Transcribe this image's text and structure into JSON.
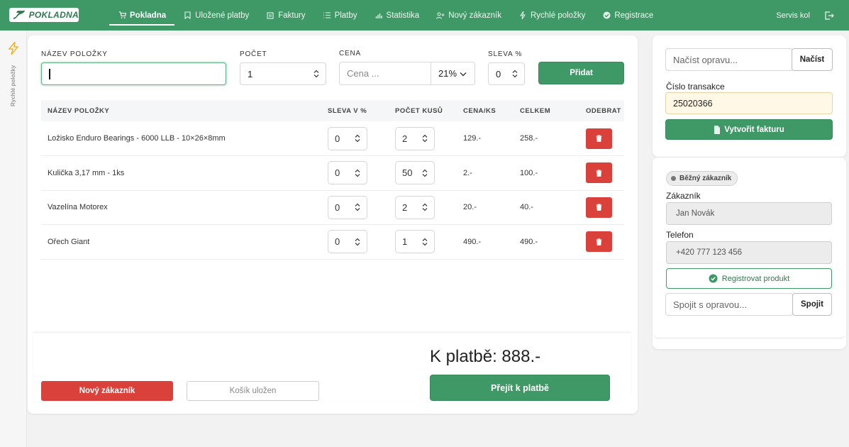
{
  "brand": {
    "name": "POKLADNA"
  },
  "nav": {
    "items": [
      {
        "label": "Pokladna",
        "icon": "cart-icon",
        "active": true
      },
      {
        "label": "Uložené platby",
        "icon": "bookmark-icon",
        "active": false
      },
      {
        "label": "Faktury",
        "icon": "document-icon",
        "active": false
      },
      {
        "label": "Platby",
        "icon": "list-icon",
        "active": false
      },
      {
        "label": "Statistika",
        "icon": "chart-icon",
        "active": false
      },
      {
        "label": "Nový zákazník",
        "icon": "user-plus-icon",
        "active": false
      },
      {
        "label": "Rychlé položky",
        "icon": "bolt-icon",
        "active": false
      },
      {
        "label": "Registrace",
        "icon": "check-badge-icon",
        "active": false
      }
    ],
    "user": "Servis kol"
  },
  "rail": {
    "label": "Rychlé položky"
  },
  "form": {
    "name_label": "NÁZEV POLOŽKY",
    "name_value": "",
    "count_label": "POČET",
    "count_value": "1",
    "price_label": "CENA",
    "price_placeholder": "Cena ...",
    "vat_value": "21%",
    "discount_label": "SLEVA %",
    "discount_value": "0",
    "add_label": "Přidat"
  },
  "table": {
    "headers": [
      "NÁZEV POLOŽKY",
      "SLEVA V %",
      "POČET KUSŮ",
      "CENA/KS",
      "CELKEM",
      "ODEBRAT"
    ],
    "rows": [
      {
        "name": "Ložisko Enduro Bearings - 6000 LLB - 10×26×8mm",
        "discount": "0",
        "qty": "2",
        "unit": "129.-",
        "total": "258.-"
      },
      {
        "name": "Kulička 3,17 mm - 1ks",
        "discount": "0",
        "qty": "50",
        "unit": "2.-",
        "total": "100.-"
      },
      {
        "name": "Vazelína Motorex",
        "discount": "0",
        "qty": "2",
        "unit": "20.-",
        "total": "40.-"
      },
      {
        "name": "Ořech Giant",
        "discount": "0",
        "qty": "1",
        "unit": "490.-",
        "total": "490.-"
      }
    ]
  },
  "footer": {
    "total": "K platbě: 888.-",
    "new_customer": "Nový zákazník",
    "cart_saved": "Košík uložen",
    "pay": "Přejít k platbě"
  },
  "right": {
    "load_placeholder": "Načíst opravu...",
    "load_button": "Načíst",
    "transaction_label": "Číslo transakce",
    "transaction_value": "25020366",
    "invoice_button": "Vytvořit fakturu",
    "badge": "Běžný zákazník",
    "customer_label": "Zákazník",
    "customer_value": "Jan Novák",
    "phone_label": "Telefon",
    "phone_value": "+420 777 123 456",
    "register_button": "Registrovat produkt",
    "link_placeholder": "Spojit s opravou...",
    "link_button": "Spojit"
  },
  "colors": {
    "accent": "#3f9966",
    "danger": "#d9413a",
    "highlight": "#fff8e6"
  }
}
